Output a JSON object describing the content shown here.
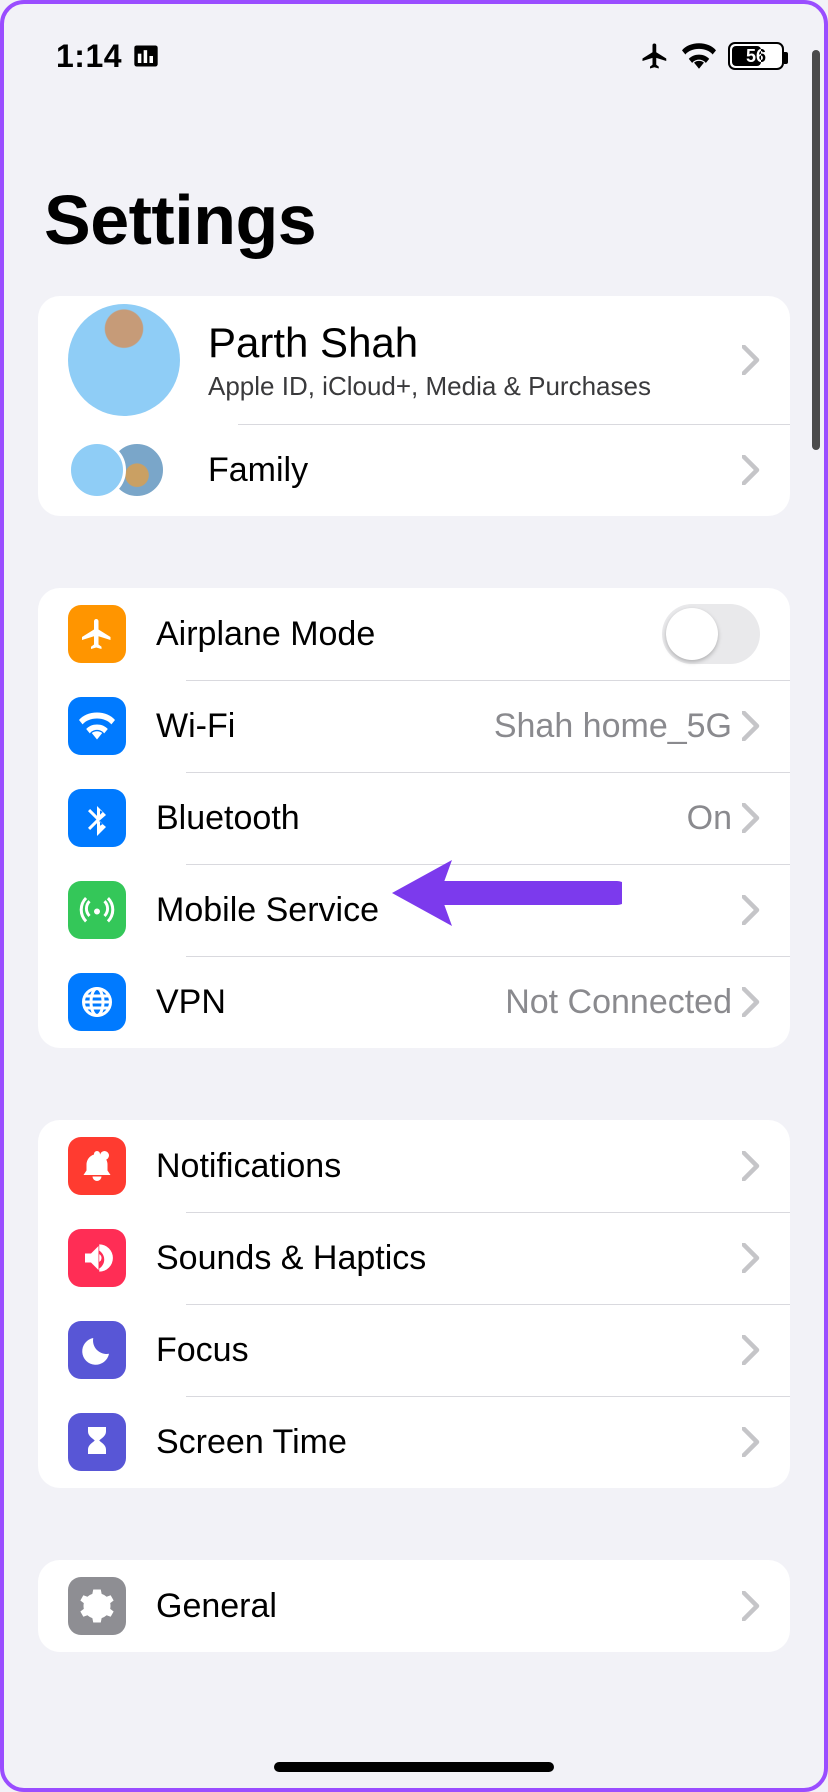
{
  "status": {
    "time": "1:14",
    "battery_pct": "56"
  },
  "title": "Settings",
  "profile": {
    "name": "Parth Shah",
    "subtitle": "Apple ID, iCloud+, Media & Purchases",
    "family_label": "Family"
  },
  "network": {
    "airplane": {
      "label": "Airplane Mode"
    },
    "wifi": {
      "label": "Wi-Fi",
      "value": "Shah home_5G"
    },
    "bluetooth": {
      "label": "Bluetooth",
      "value": "On"
    },
    "mobile": {
      "label": "Mobile Service"
    },
    "vpn": {
      "label": "VPN",
      "value": "Not Connected"
    }
  },
  "general": {
    "notifications": {
      "label": "Notifications"
    },
    "sounds": {
      "label": "Sounds & Haptics"
    },
    "focus": {
      "label": "Focus"
    },
    "screentime": {
      "label": "Screen Time"
    }
  },
  "more": {
    "general": {
      "label": "General"
    }
  },
  "colors": {
    "accent_arrow": "#7c3aed"
  }
}
